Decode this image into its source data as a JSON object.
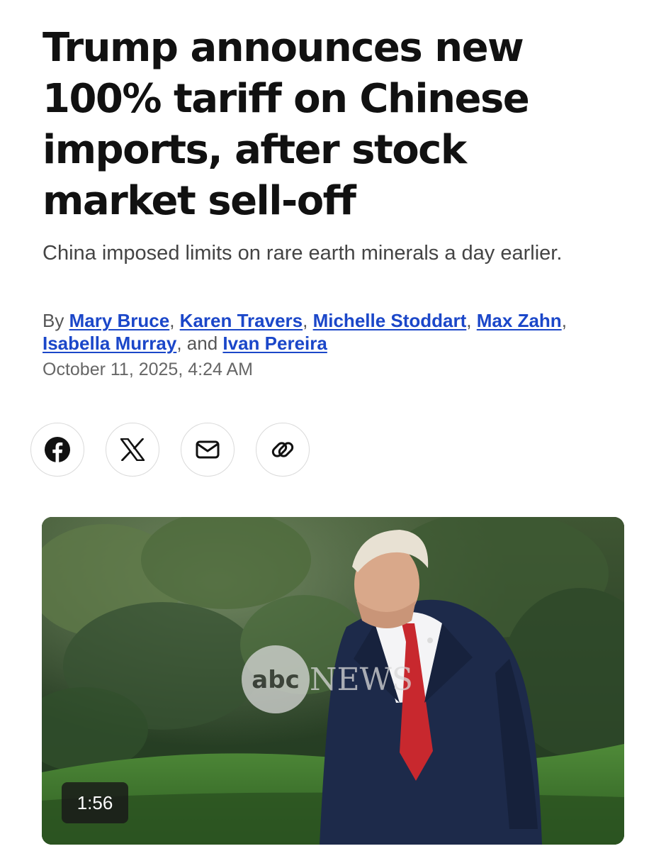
{
  "article": {
    "headline": "Trump announces new 100% tariff on Chinese imports, after stock market sell-off",
    "subheadline": "China imposed limits on rare earth minerals a day earlier.",
    "byline": {
      "prefix": "By",
      "authors": [
        "Mary Bruce",
        "Karen Travers",
        "Michelle Stoddart",
        "Max Zahn",
        "Isabella Murray",
        "Ivan Pereira"
      ],
      "separator": ",",
      "conjunction": "and"
    },
    "date": "October 11, 2025, 4:24 AM"
  },
  "share": {
    "buttons": [
      {
        "icon": "facebook-icon"
      },
      {
        "icon": "x-icon"
      },
      {
        "icon": "email-icon"
      },
      {
        "icon": "link-icon"
      }
    ]
  },
  "video": {
    "duration": "1:56",
    "watermark": "abcNEWS"
  },
  "colors": {
    "link": "#1b47c9",
    "headline": "#111111",
    "subhead": "#444444",
    "meta": "#666666"
  }
}
